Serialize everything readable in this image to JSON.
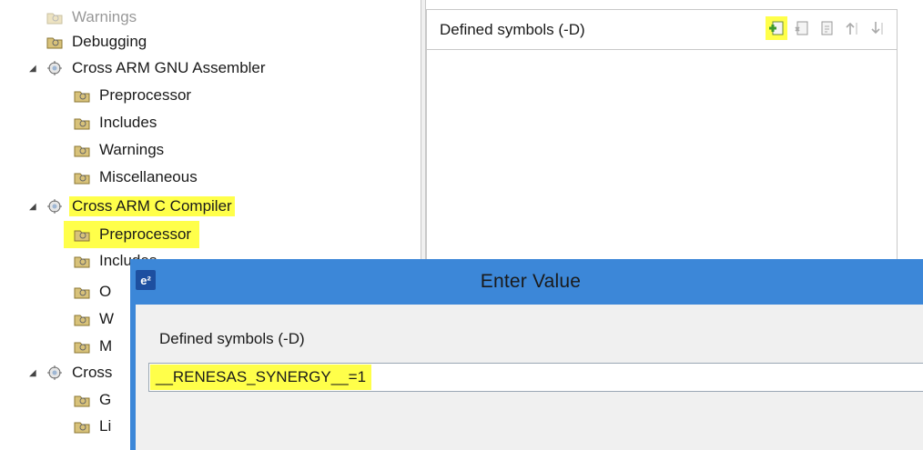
{
  "tree": {
    "items": [
      {
        "label": "Warnings"
      },
      {
        "label": "Debugging"
      },
      {
        "label": "Cross ARM GNU Assembler"
      },
      {
        "label": "Preprocessor"
      },
      {
        "label": "Includes"
      },
      {
        "label": "Warnings"
      },
      {
        "label": "Miscellaneous"
      },
      {
        "label": "Cross ARM C Compiler"
      },
      {
        "label": "Preprocessor"
      },
      {
        "label": "Includes"
      },
      {
        "label": "O"
      },
      {
        "label": "W"
      },
      {
        "label": "M"
      },
      {
        "label": "Cross"
      },
      {
        "label": "G"
      },
      {
        "label": "Li"
      }
    ]
  },
  "panel": {
    "title": "Defined symbols (-D)",
    "toolbar": [
      "add-icon",
      "delete-icon",
      "edit-icon",
      "move-up-icon",
      "move-down-icon"
    ]
  },
  "dialog": {
    "icon_text": "e²",
    "title": "Enter Value",
    "label": "Defined symbols (-D)",
    "value": "__RENESAS_SYNERGY__=1"
  },
  "colors": {
    "highlight": "#ffff4a",
    "dialog_frame": "#3c87d8"
  }
}
